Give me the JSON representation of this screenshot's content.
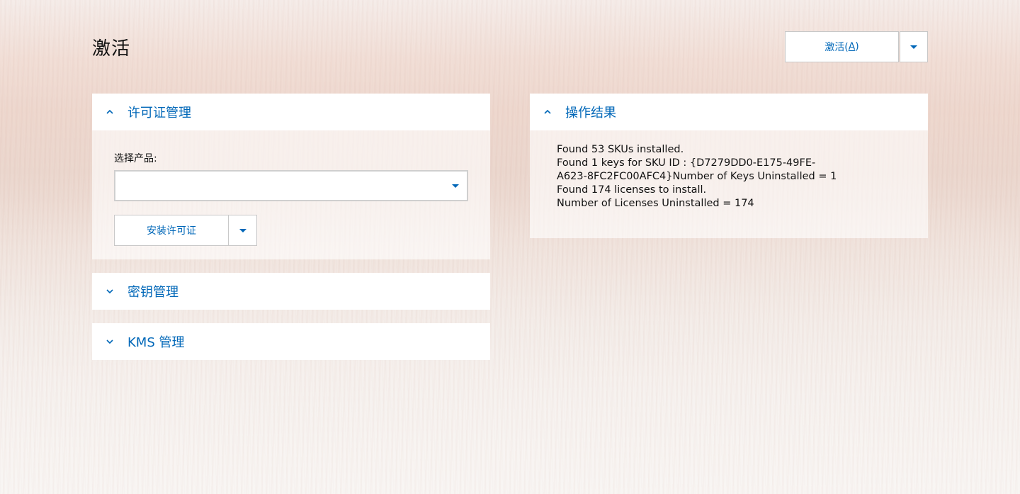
{
  "page": {
    "title": "激活",
    "activate_button_label": "激活(",
    "activate_button_access_key": "A",
    "activate_button_close": ")"
  },
  "license_panel": {
    "header": "许可证管理",
    "expanded": true,
    "select_label": "选择产品:",
    "select_value": "",
    "install_button_label": "安装许可证"
  },
  "key_panel": {
    "header": "密钥管理",
    "expanded": false
  },
  "kms_panel": {
    "header": "KMS 管理",
    "expanded": false
  },
  "result_panel": {
    "header": "操作结果",
    "expanded": true,
    "lines": [
      "Found 53 SKUs installed.",
      "Found 1 keys for SKU ID : {D7279DD0-E175-49FE-",
      "A623-8FC2FC00AFC4}Number of Keys Uninstalled = 1",
      "Found 174 licenses to install.",
      "Number of Licenses Uninstalled = 174"
    ]
  },
  "colors": {
    "accent": "#0067b8"
  },
  "icons": {
    "expanded": "chevron-up-icon",
    "collapsed": "chevron-down-icon",
    "dropdown": "caret-down-icon"
  }
}
